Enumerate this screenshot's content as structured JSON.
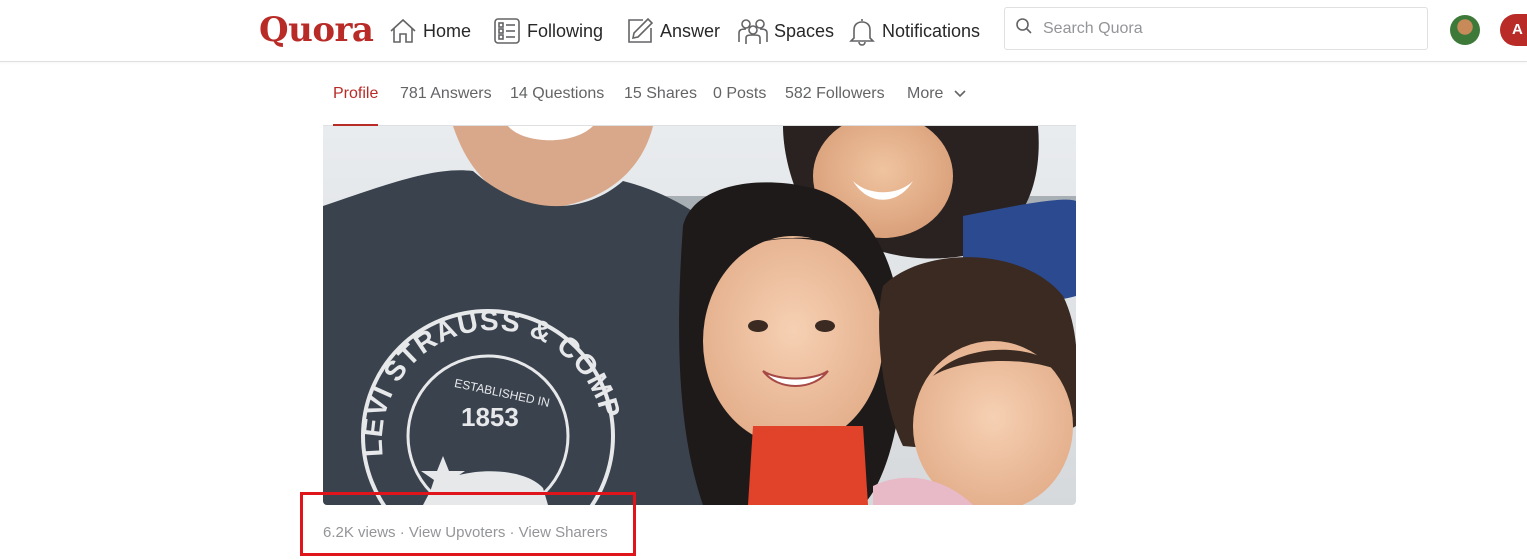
{
  "header": {
    "logo": "Quora",
    "nav": [
      {
        "label": "Home",
        "icon": "home-icon"
      },
      {
        "label": "Following",
        "icon": "following-icon"
      },
      {
        "label": "Answer",
        "icon": "answer-icon"
      },
      {
        "label": "Spaces",
        "icon": "spaces-icon"
      },
      {
        "label": "Notifications",
        "icon": "bell-icon"
      }
    ],
    "search": {
      "placeholder": "Search Quora",
      "value": ""
    },
    "add_button": "A"
  },
  "profile_tabs": [
    {
      "label": "Profile",
      "active": true
    },
    {
      "label": "781 Answers",
      "active": false
    },
    {
      "label": "14 Questions",
      "active": false
    },
    {
      "label": "15 Shares",
      "active": false
    },
    {
      "label": "0 Posts",
      "active": false
    },
    {
      "label": "582 Followers",
      "active": false
    },
    {
      "label": "More",
      "active": false
    }
  ],
  "stats": {
    "views": "6.2K views",
    "separator": " · ",
    "upvoters": "View Upvoters",
    "sharers": "View Sharers"
  },
  "tshirt_print": {
    "line1": "LEVI STRAUSS & COMPANY",
    "line2": "ESTABLISHED IN",
    "line3": "1853"
  },
  "colors": {
    "brand": "#b92b27",
    "highlight_box": "#e0141b",
    "muted_text": "#939598"
  }
}
